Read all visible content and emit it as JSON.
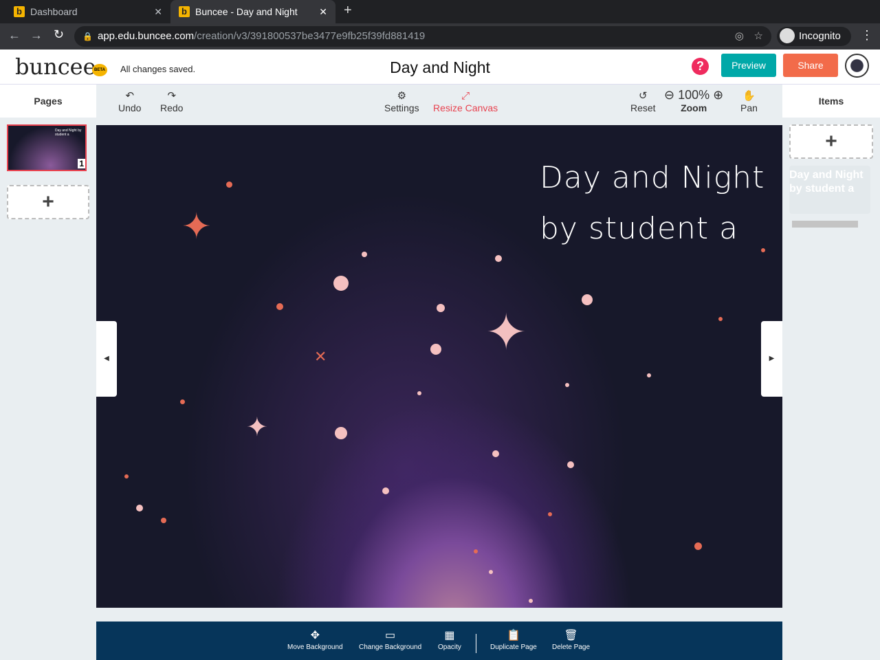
{
  "browser": {
    "tabs": [
      {
        "label": "Dashboard"
      },
      {
        "label": "Buncee - Day and Night"
      }
    ],
    "url_host": "app.edu.buncee.com",
    "url_path": "/creation/v3/391800537be3477e9fb25f39fd881419",
    "profile": "Incognito"
  },
  "header": {
    "logo": "buncee",
    "beta": "BETA",
    "status": "All changes saved.",
    "title": "Day and Night",
    "help": "?",
    "preview": "Preview",
    "share": "Share"
  },
  "toolbar": {
    "undo": "Undo",
    "redo": "Redo",
    "settings": "Settings",
    "resize": "Resize Canvas",
    "reset": "Reset",
    "zoom_value": "100%",
    "zoom": "Zoom",
    "pan": "Pan"
  },
  "pages": {
    "title": "Pages",
    "page_number": "1",
    "add": "+",
    "thumb_text": "Day and Night by student a"
  },
  "items": {
    "title": "Items",
    "add": "+",
    "item_text": "Day and Night by student a"
  },
  "canvas": {
    "line1": "Day and Night",
    "line2": "by student a"
  },
  "bottom": {
    "move": "Move Background",
    "change": "Change Background",
    "opacity": "Opacity",
    "duplicate": "Duplicate Page",
    "delete": "Delete Page"
  },
  "colors": {
    "preview": "#00a8a8",
    "share": "#f26b4a",
    "help": "#ef2b5e",
    "resize": "#e8424f",
    "bottombar": "#06355a"
  }
}
